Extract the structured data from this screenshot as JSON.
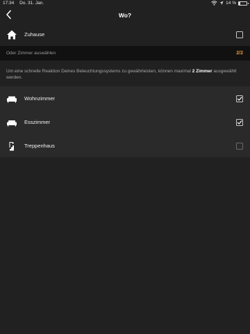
{
  "status_bar": {
    "time": "17:34",
    "date": "Do. 31. Jan.",
    "battery_text": "14 %",
    "battery_level": 0.14
  },
  "nav": {
    "title": "Wo?"
  },
  "home": {
    "label": "Zuhause",
    "checked": false
  },
  "rooms_header": {
    "label": "Oder Zimmer auswählen",
    "counter": "2/2",
    "accent_color": "#e8933a"
  },
  "info": {
    "text_before": "Um eine schnelle Reaktion Deines Beleuchtungssystems zu gewährleisten, können maximal ",
    "highlight": "2 Zimmer",
    "text_after": " ausgewählt werden."
  },
  "rooms": [
    {
      "label": "Wohnzimmer",
      "icon": "sofa-icon",
      "checked": true
    },
    {
      "label": "Esszimmer",
      "icon": "dining-table-icon",
      "checked": true
    },
    {
      "label": "Treppenhaus",
      "icon": "staircase-icon",
      "checked": false
    }
  ]
}
